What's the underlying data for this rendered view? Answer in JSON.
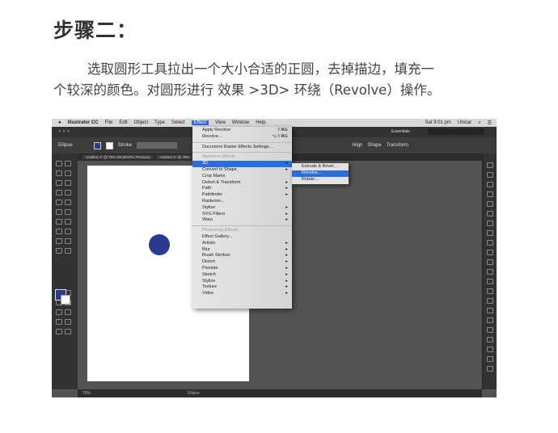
{
  "article": {
    "title": "步骤二：",
    "lines": [
      "选取圆形工具拉出一个大小合适的正圆，去掉描边，填充一",
      "个较深的颜色。对圆形进行 效果 >3D> 环绕（Revolve）操作。"
    ]
  },
  "app": {
    "menubar": [
      "Illustrator CC",
      "File",
      "Edit",
      "Object",
      "Type",
      "Select",
      "Effect",
      "View",
      "Window",
      "Help"
    ],
    "active_menu": "Effect",
    "clock": "Sat 9:01 pm",
    "user": "Unicar",
    "workspace": "Essentials",
    "control": {
      "label": "Ellipse",
      "stroke": "Stroke",
      "align": "Align",
      "shape": "Shape",
      "transform": "Transform"
    },
    "tabs": [
      "Untitled-1* @ 78% (RGB/GPU Preview)",
      "Untitled-1* @ 78%"
    ],
    "status": {
      "zoom": "78%",
      "tool": "Ellipse"
    },
    "circle_color": "#2b3990",
    "effect_menu": [
      {
        "label": "Apply Revolve",
        "shortcut": "⇧⌘E"
      },
      {
        "label": "Revolve...",
        "shortcut": "⌥⇧⌘E"
      },
      {
        "sep": true
      },
      {
        "label": "Document Raster Effects Settings..."
      },
      {
        "sep": true
      },
      {
        "label": "Illustrator Effects",
        "header": true
      },
      {
        "label": "3D",
        "arrow": true,
        "selected": true
      },
      {
        "label": "Convert to Shape",
        "arrow": true
      },
      {
        "label": "Crop Marks"
      },
      {
        "label": "Distort & Transform",
        "arrow": true
      },
      {
        "label": "Path",
        "arrow": true
      },
      {
        "label": "Pathfinder",
        "arrow": true
      },
      {
        "label": "Rasterize..."
      },
      {
        "label": "Stylize",
        "arrow": true
      },
      {
        "label": "SVG Filters",
        "arrow": true
      },
      {
        "label": "Warp",
        "arrow": true
      },
      {
        "sep": true
      },
      {
        "label": "Photoshop Effects",
        "header": true
      },
      {
        "label": "Effect Gallery..."
      },
      {
        "label": "Artistic",
        "arrow": true
      },
      {
        "label": "Blur",
        "arrow": true
      },
      {
        "label": "Brush Strokes",
        "arrow": true
      },
      {
        "label": "Distort",
        "arrow": true
      },
      {
        "label": "Pixelate",
        "arrow": true
      },
      {
        "label": "Sketch",
        "arrow": true
      },
      {
        "label": "Stylize",
        "arrow": true
      },
      {
        "label": "Texture",
        "arrow": true
      },
      {
        "label": "Video",
        "arrow": true
      }
    ],
    "submenu": [
      {
        "label": "Extrude & Bevel..."
      },
      {
        "label": "Revolve...",
        "selected": true
      },
      {
        "label": "Rotate..."
      }
    ]
  }
}
